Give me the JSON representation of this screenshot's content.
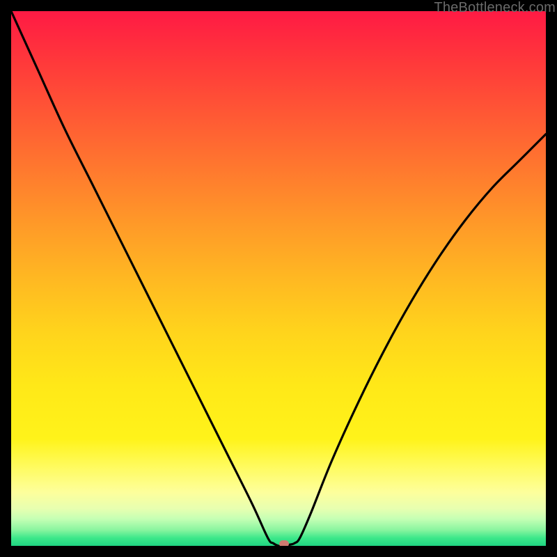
{
  "watermark": "TheBottleneck.com",
  "chart_data": {
    "type": "line",
    "title": "",
    "xlabel": "",
    "ylabel": "",
    "xlim": [
      0,
      100
    ],
    "ylim": [
      0,
      100
    ],
    "grid": false,
    "series": [
      {
        "name": "bottleneck-curve",
        "x": [
          0,
          5,
          10,
          15,
          20,
          25,
          30,
          35,
          40,
          45,
          48,
          49,
          50,
          51,
          52,
          53,
          54,
          56,
          60,
          65,
          70,
          75,
          80,
          85,
          90,
          95,
          100
        ],
        "values": [
          100,
          89,
          78,
          68,
          58,
          48,
          38,
          28,
          18,
          8,
          1.5,
          0.5,
          0,
          0,
          0.2,
          0.5,
          1.5,
          6,
          16,
          27,
          37,
          46,
          54,
          61,
          67,
          72,
          77
        ]
      }
    ],
    "annotations": [
      {
        "name": "optimal-marker",
        "x": 51,
        "y": 0
      }
    ],
    "colors": {
      "curve": "#000000",
      "marker": "#cf7a70",
      "gradient_top": "#ff1a44",
      "gradient_bottom": "#1fd482"
    }
  }
}
